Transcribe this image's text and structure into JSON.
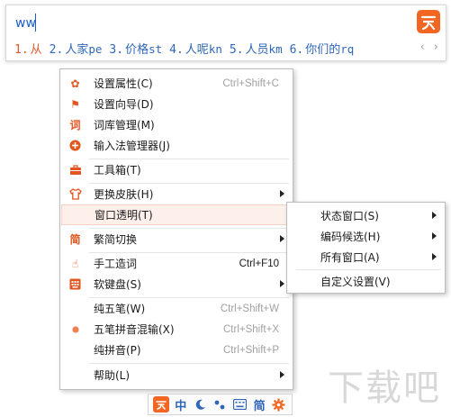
{
  "candidate_window": {
    "composition": "ww",
    "candidates": [
      {
        "index": "1.",
        "text": "从",
        "code": ""
      },
      {
        "index": "2.",
        "text": "人家",
        "code": "pe"
      },
      {
        "index": "3.",
        "text": "价格",
        "code": "st"
      },
      {
        "index": "4.",
        "text": "人呢",
        "code": "kn"
      },
      {
        "index": "5.",
        "text": "人员",
        "code": "km"
      },
      {
        "index": "6.",
        "text": "你们的",
        "code": "rq"
      }
    ],
    "prev": "‹",
    "next": "›"
  },
  "menu": {
    "items": [
      {
        "label": "设置属性(C)",
        "shortcut": "Ctrl+Shift+C",
        "icon": "gear-icon"
      },
      {
        "label": "设置向导(D)",
        "shortcut": "",
        "icon": "flag-icon"
      },
      {
        "label": "词库管理(M)",
        "shortcut": "",
        "icon": "dictionary-icon"
      },
      {
        "label": "输入法管理器(J)",
        "shortcut": "",
        "icon": "manager-icon"
      },
      {
        "label": "工具箱(T)",
        "shortcut": "",
        "icon": "toolbox-icon"
      },
      {
        "label": "更换皮肤(H)",
        "shortcut": "",
        "icon": "shirt-icon"
      },
      {
        "label": "窗口透明(T)",
        "shortcut": "",
        "icon": ""
      },
      {
        "label": "繁简切换",
        "shortcut": "",
        "icon": "simplified-icon"
      },
      {
        "label": "手工造词",
        "shortcut": "Ctrl+F10",
        "icon": "hand-icon"
      },
      {
        "label": "软键盘(S)",
        "shortcut": "",
        "icon": "soft-keyboard-icon"
      },
      {
        "label": "纯五笔(W)",
        "shortcut": "Ctrl+Shift+W",
        "icon": ""
      },
      {
        "label": "五笔拼音混输(X)",
        "shortcut": "Ctrl+Shift+X",
        "icon": "bullet-icon"
      },
      {
        "label": "纯拼音(P)",
        "shortcut": "Ctrl+Shift+P",
        "icon": ""
      },
      {
        "label": "帮助(L)",
        "shortcut": "",
        "icon": ""
      }
    ]
  },
  "submenu": {
    "items": [
      {
        "label": "状态窗口(S)"
      },
      {
        "label": "编码候选(H)"
      },
      {
        "label": "所有窗口(A)"
      },
      {
        "label": "自定义设置(V)"
      }
    ]
  },
  "status_bar": {
    "lang": "中",
    "punct": "简"
  },
  "watermark": "下载吧",
  "colors": {
    "accent": "#f26522",
    "candidate": "#2f66b8",
    "first_candidate": "#e2592b"
  }
}
